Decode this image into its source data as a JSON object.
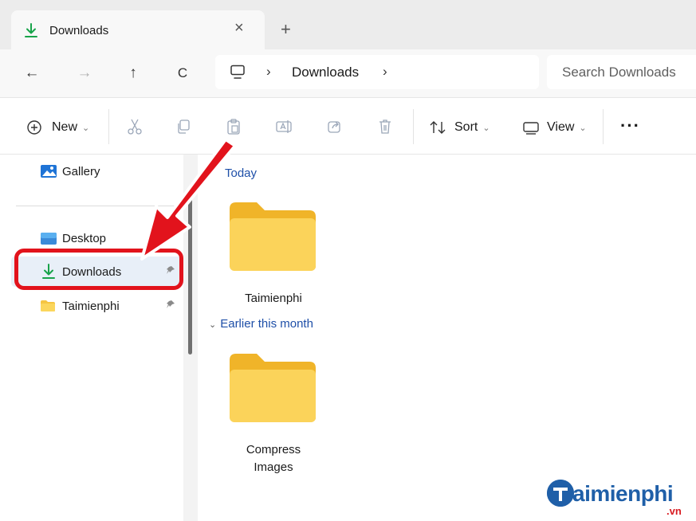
{
  "tab": {
    "label": "Downloads",
    "close_glyph": "×",
    "new_tab_glyph": "+",
    "icon": "download-icon"
  },
  "nav": {
    "back": "←",
    "forward": "→",
    "up": "↑",
    "refresh": "C"
  },
  "address": {
    "icon": "pc-icon",
    "separator": "›",
    "crumb": "Downloads",
    "trailing_separator": "›"
  },
  "search": {
    "placeholder": "Search Downloads"
  },
  "commands": {
    "new_label": "New",
    "sort_label": "Sort",
    "view_label": "View",
    "caret": "⌄",
    "more": "···",
    "icons": [
      "plus-circle-icon",
      "cut-icon",
      "copy-icon",
      "paste-icon",
      "rename-icon",
      "share-icon",
      "delete-icon",
      "sort-icon",
      "view-icon"
    ]
  },
  "sidebar": {
    "items": [
      {
        "label": "Gallery",
        "icon": "gallery-icon",
        "pinned": false
      },
      {
        "label": "Desktop",
        "icon": "desktop-icon",
        "pinned": false
      },
      {
        "label": "Downloads",
        "icon": "download-icon",
        "pinned": true,
        "selected": true
      },
      {
        "label": "Taimienphi",
        "icon": "folder-icon",
        "pinned": true
      }
    ],
    "pin_glyph": "📌"
  },
  "main": {
    "groups": [
      {
        "title": "Today",
        "folders": [
          {
            "label": "Taimienphi"
          }
        ]
      },
      {
        "title": "Earlier this month",
        "collapse_glyph": "⌄",
        "folders": [
          {
            "label_line1": "Compress",
            "label_line2": "Images"
          }
        ]
      }
    ]
  },
  "watermark": {
    "text": "aimienphi",
    "suffix": ".vn"
  },
  "colors": {
    "accent_blue": "#1e4fa8",
    "highlight_red": "#e2131c",
    "folder_yellow": "#f5c542",
    "selected_bg": "#e8eff8"
  }
}
